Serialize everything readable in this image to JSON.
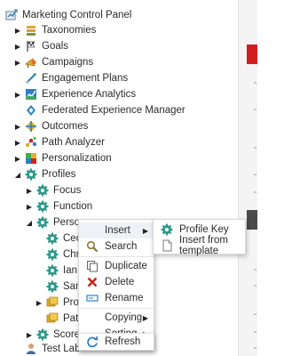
{
  "tree": {
    "root": "Marketing Control Panel",
    "items": [
      "Taxonomies",
      "Goals",
      "Campaigns",
      "Engagement Plans",
      "Experience Analytics",
      "Federated Experience Manager",
      "Outcomes",
      "Path Analyzer",
      "Personalization",
      "Profiles",
      "Focus",
      "Function",
      "Persona",
      "Cecile",
      "Chris",
      "Ian",
      "Sandra",
      "Profile",
      "Patterns",
      "Score",
      "Test Lab"
    ],
    "visible_labels": {
      "cecile": "Cecile",
      "chris": "Chris",
      "ian": "Ian",
      "sandra": "Sandr",
      "profile": "Profile",
      "patterns": "Patter"
    }
  },
  "context_menu": {
    "insert": "Insert",
    "search": "Search",
    "duplicate": "Duplicate",
    "delete": "Delete",
    "rename": "Rename",
    "copying": "Copying",
    "sorting": "Sorting",
    "refresh": "Refresh"
  },
  "insert_submenu": {
    "profile_key": "Profile Key",
    "insert_from_template": "Insert from template"
  },
  "colors": {
    "accent_red": "#d11f1f",
    "gear_teal": "#2c9a8a",
    "delete_red": "#d0241c",
    "refresh_blue": "#2d7fc6"
  }
}
